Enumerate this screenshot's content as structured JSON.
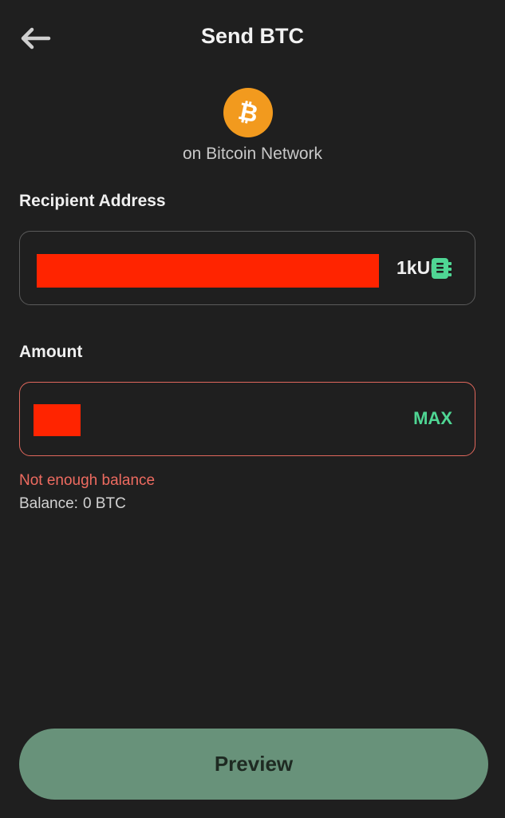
{
  "header": {
    "title": "Send BTC",
    "back_icon": "arrow-left-icon"
  },
  "asset": {
    "icon": "bitcoin-icon",
    "icon_color": "#f29a1e",
    "network_label": "on Bitcoin Network"
  },
  "recipient": {
    "label": "Recipient Address",
    "value_visible_tail": "1kUι",
    "address_book_icon": "address-book-icon",
    "icon_color": "#4fd694"
  },
  "amount": {
    "label": "Amount",
    "max_label": "MAX",
    "error": "Not enough balance",
    "balance_label": "Balance:",
    "balance_value": "0 BTC",
    "error_color": "#ee6b60",
    "accent_color": "#4fd694"
  },
  "footer": {
    "preview_label": "Preview",
    "button_color": "#68927a"
  }
}
